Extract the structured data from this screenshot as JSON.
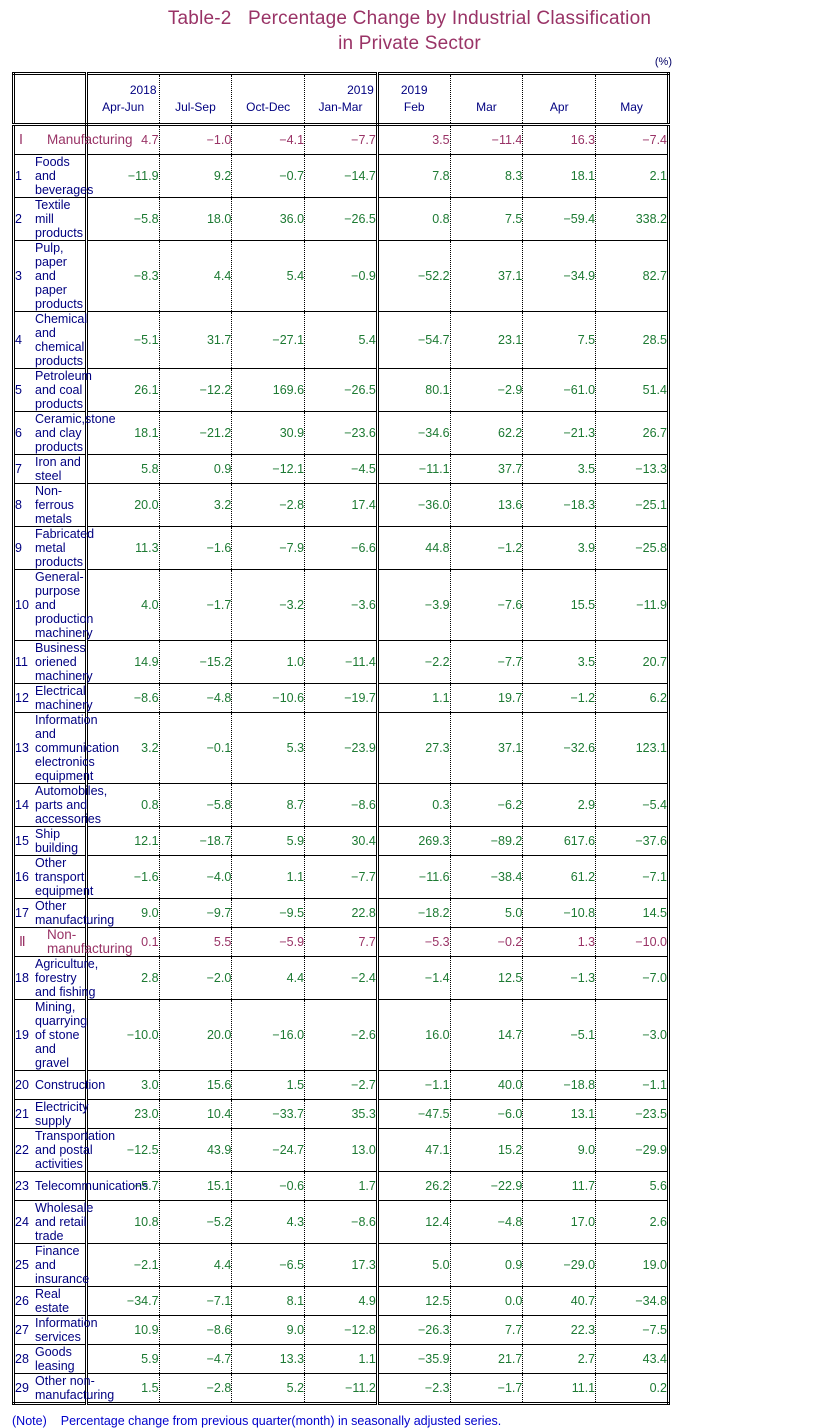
{
  "title": {
    "line1": "Table-2   Percentage Change by Industrial Classification",
    "line2": "in Private Sector"
  },
  "unit_label": "(%)",
  "colors": {
    "title": "#993366",
    "section": "#993366",
    "label": "#000080",
    "value": "#1d7a33",
    "note": "#0000cc"
  },
  "header": {
    "blank": "",
    "columns": [
      {
        "top": "2018",
        "bottom": "Apr-Jun"
      },
      {
        "top": "",
        "bottom": "Jul-Sep"
      },
      {
        "top": "",
        "bottom": "Oct-Dec"
      },
      {
        "top": "2019",
        "bottom": "Jan-Mar"
      },
      {
        "top": "2019",
        "bottom": "Feb"
      },
      {
        "top": "",
        "bottom": "Mar"
      },
      {
        "top": "",
        "bottom": "Apr"
      },
      {
        "top": "",
        "bottom": "May"
      }
    ]
  },
  "note": {
    "tag": "(Note)",
    "text": "Percentage change from previous quarter(month) in seasonally adjusted series."
  },
  "chart_data": {
    "type": "table",
    "title": "Table-2   Percentage Change by Industrial Classification in Private Sector",
    "unit": "%",
    "columns": [
      "2018 Apr-Jun",
      "2018 Jul-Sep",
      "2018 Oct-Dec",
      "2019 Jan-Mar",
      "2019 Feb",
      "2019 Mar",
      "2019 Apr",
      "2019 May"
    ],
    "note": "Percentage change from previous quarter(month) in seasonally adjusted series."
  },
  "rows": [
    {
      "num": "Ⅰ",
      "label": "Manufacturing",
      "kind": "section",
      "values": [
        "4.7",
        "−1.0",
        "−4.1",
        "−7.7",
        "3.5",
        "−11.4",
        "16.3",
        "−7.4"
      ]
    },
    {
      "num": "1",
      "label": "Foods and beverages",
      "kind": "item",
      "values": [
        "−11.9",
        "9.2",
        "−0.7",
        "−14.7",
        "7.8",
        "8.3",
        "18.1",
        "2.1"
      ]
    },
    {
      "num": "2",
      "label": "Textile mill products",
      "kind": "item",
      "values": [
        "−5.8",
        "18.0",
        "36.0",
        "−26.5",
        "0.8",
        "7.5",
        "−59.4",
        "338.2"
      ]
    },
    {
      "num": "3",
      "label": "Pulp, paper and paper products",
      "kind": "item",
      "values": [
        "−8.3",
        "4.4",
        "5.4",
        "−0.9",
        "−52.2",
        "37.1",
        "−34.9",
        "82.7"
      ]
    },
    {
      "num": "4",
      "label": "Chemical and chemical products",
      "kind": "item",
      "values": [
        "−5.1",
        "31.7",
        "−27.1",
        "5.4",
        "−54.7",
        "23.1",
        "7.5",
        "28.5"
      ]
    },
    {
      "num": "5",
      "label": "Petroleum and coal products",
      "kind": "item",
      "values": [
        "26.1",
        "−12.2",
        "169.6",
        "−26.5",
        "80.1",
        "−2.9",
        "−61.0",
        "51.4"
      ]
    },
    {
      "num": "6",
      "label": "Ceramic,stone and clay products",
      "kind": "item",
      "values": [
        "18.1",
        "−21.2",
        "30.9",
        "−23.6",
        "−34.6",
        "62.2",
        "−21.3",
        "26.7"
      ]
    },
    {
      "num": "7",
      "label": "Iron and steel",
      "kind": "item",
      "values": [
        "5.8",
        "0.9",
        "−12.1",
        "−4.5",
        "−11.1",
        "37.7",
        "3.5",
        "−13.3"
      ]
    },
    {
      "num": "8",
      "label": "Non-ferrous metals",
      "kind": "item",
      "values": [
        "20.0",
        "3.2",
        "−2.8",
        "17.4",
        "−36.0",
        "13.6",
        "−18.3",
        "−25.1"
      ]
    },
    {
      "num": "9",
      "label": "Fabricated metal products",
      "kind": "item",
      "values": [
        "11.3",
        "−1.6",
        "−7.9",
        "−6.6",
        "44.8",
        "−1.2",
        "3.9",
        "−25.8"
      ]
    },
    {
      "num": "10",
      "label": "General-purpose and production machinery",
      "kind": "item",
      "tall": true,
      "values": [
        "4.0",
        "−1.7",
        "−3.2",
        "−3.6",
        "−3.9",
        "−7.6",
        "15.5",
        "−11.9"
      ]
    },
    {
      "num": "11",
      "label": "Business oriened machinery",
      "kind": "item",
      "values": [
        "14.9",
        "−15.2",
        "1.0",
        "−11.4",
        "−2.2",
        "−7.7",
        "3.5",
        "20.7"
      ]
    },
    {
      "num": "12",
      "label": "Electrical machinery",
      "kind": "item",
      "values": [
        "−8.6",
        "−4.8",
        "−10.6",
        "−19.7",
        "1.1",
        "19.7",
        "−1.2",
        "6.2"
      ]
    },
    {
      "num": "13",
      "label": "Information and communication electronics equipment",
      "kind": "item",
      "tall": true,
      "values": [
        "3.2",
        "−0.1",
        "5.3",
        "−23.9",
        "27.3",
        "37.1",
        "−32.6",
        "123.1"
      ]
    },
    {
      "num": "14",
      "label": "Automobiles, parts and accessories",
      "kind": "item",
      "tall": true,
      "values": [
        "0.8",
        "−5.8",
        "8.7",
        "−8.6",
        "0.3",
        "−6.2",
        "2.9",
        "−5.4"
      ]
    },
    {
      "num": "15",
      "label": "Ship building",
      "kind": "item",
      "values": [
        "12.1",
        "−18.7",
        "5.9",
        "30.4",
        "269.3",
        "−89.2",
        "617.6",
        "−37.6"
      ]
    },
    {
      "num": "16",
      "label": "Other transport equipment",
      "kind": "item",
      "values": [
        "−1.6",
        "−4.0",
        "1.1",
        "−7.7",
        "−11.6",
        "−38.4",
        "61.2",
        "−7.1"
      ]
    },
    {
      "num": "17",
      "label": "Other manufacturing",
      "kind": "item",
      "values": [
        "9.0",
        "−9.7",
        "−9.5",
        "22.8",
        "−18.2",
        "5.0",
        "−10.8",
        "14.5"
      ]
    },
    {
      "num": "Ⅱ",
      "label": "Non-manufacturing",
      "kind": "section",
      "values": [
        "0.1",
        "5.5",
        "−5.9",
        "7.7",
        "−5.3",
        "−0.2",
        "1.3",
        "−10.0"
      ]
    },
    {
      "num": "18",
      "label": "Agriculture, forestry and fishing",
      "kind": "item",
      "values": [
        "2.8",
        "−2.0",
        "4.4",
        "−2.4",
        "−1.4",
        "12.5",
        "−1.3",
        "−7.0"
      ]
    },
    {
      "num": "19",
      "label": "Mining, quarrying of stone and gravel",
      "kind": "item",
      "tall": true,
      "values": [
        "−10.0",
        "20.0",
        "−16.0",
        "−2.6",
        "16.0",
        "14.7",
        "−5.1",
        "−3.0"
      ]
    },
    {
      "num": "20",
      "label": "Construction",
      "kind": "item",
      "values": [
        "3.0",
        "15.6",
        "1.5",
        "−2.7",
        "−1.1",
        "40.0",
        "−18.8",
        "−1.1"
      ]
    },
    {
      "num": "21",
      "label": "Electricity supply",
      "kind": "item",
      "values": [
        "23.0",
        "10.4",
        "−33.7",
        "35.3",
        "−47.5",
        "−6.0",
        "13.1",
        "−23.5"
      ]
    },
    {
      "num": "22",
      "label": "Transportation and postal activities",
      "kind": "item",
      "values": [
        "−12.5",
        "43.9",
        "−24.7",
        "13.0",
        "47.1",
        "15.2",
        "9.0",
        "−29.9"
      ]
    },
    {
      "num": "23",
      "label": "Telecommunications",
      "kind": "item",
      "values": [
        "−5.7",
        "15.1",
        "−0.6",
        "1.7",
        "26.2",
        "−22.9",
        "11.7",
        "5.6"
      ]
    },
    {
      "num": "24",
      "label": "Wholesale and retail trade",
      "kind": "item",
      "values": [
        "10.8",
        "−5.2",
        "4.3",
        "−8.6",
        "12.4",
        "−4.8",
        "17.0",
        "2.6"
      ]
    },
    {
      "num": "25",
      "label": "Finance and insurance",
      "kind": "item",
      "values": [
        "−2.1",
        "4.4",
        "−6.5",
        "17.3",
        "5.0",
        "0.9",
        "−29.0",
        "19.0"
      ]
    },
    {
      "num": "26",
      "label": "Real estate",
      "kind": "item",
      "values": [
        "−34.7",
        "−7.1",
        "8.1",
        "4.9",
        "12.5",
        "0.0",
        "40.7",
        "−34.8"
      ]
    },
    {
      "num": "27",
      "label": "Information services",
      "kind": "item",
      "values": [
        "10.9",
        "−8.6",
        "9.0",
        "−12.8",
        "−26.3",
        "7.7",
        "22.3",
        "−7.5"
      ]
    },
    {
      "num": "28",
      "label": "Goods leasing",
      "kind": "item",
      "values": [
        "5.9",
        "−4.7",
        "13.3",
        "1.1",
        "−35.9",
        "21.7",
        "2.7",
        "43.4"
      ]
    },
    {
      "num": "29",
      "label": "Other non-manufacturing",
      "kind": "item",
      "values": [
        "1.5",
        "−2.8",
        "5.2",
        "−11.2",
        "−2.3",
        "−1.7",
        "11.1",
        "0.2"
      ]
    }
  ]
}
